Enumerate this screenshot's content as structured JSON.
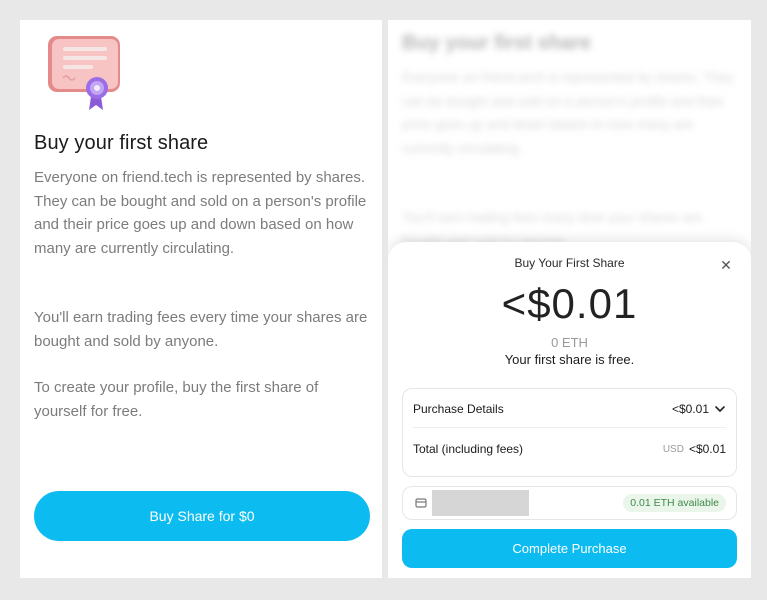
{
  "left": {
    "title": "Buy your first share",
    "para1": "Everyone on friend.tech is represented by shares. They can be bought and sold on a person's profile and their price goes up and down based on how many are currently circulating.",
    "para2": "You'll earn trading fees every time your shares are bought and sold by anyone.",
    "para3": "To create your profile, buy the first share of yourself for free.",
    "button_label": "Buy Share for $0"
  },
  "right": {
    "bg_title": "Buy your first share",
    "bg_para1": "Everyone on friend.tech is represented by shares. They can be bought and sold on a person's profile and their price goes up and down based on how many are currently circulating.",
    "bg_para2": "You'll earn trading fees every time your shares are bought and sold by anyone.",
    "sheet": {
      "title": "Buy Your First Share",
      "close": "✕",
      "price": "<$0.01",
      "eth": "0 ETH",
      "free_note": "Your first share is free.",
      "details_label": "Purchase Details",
      "details_value": "<$0.01",
      "total_label": "Total (including fees)",
      "total_currency": "USD",
      "total_value": "<$0.01",
      "eth_available": "0.01 ETH available",
      "complete_label": "Complete Purchase"
    }
  },
  "colors": {
    "accent": "#0cbcf1",
    "page_bg": "#e8e8e8",
    "eth_badge_text": "#3f8a4a",
    "eth_badge_bg": "#eaf6ea"
  },
  "icons": {
    "certificate": "certificate-icon",
    "close": "close-icon",
    "chevron": "chevron-down-icon",
    "wallet": "wallet-icon"
  }
}
